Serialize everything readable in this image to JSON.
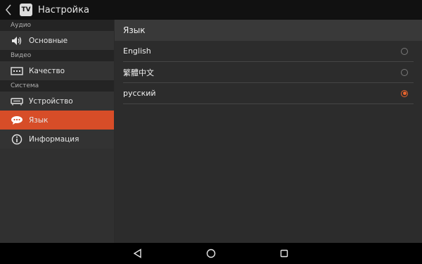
{
  "app": {
    "title": "Настройка",
    "logo_text": "TV"
  },
  "sidebar": {
    "sections": [
      {
        "header": "Аудио",
        "items": [
          {
            "label": "Основные",
            "icon": "speaker-icon",
            "active": false
          }
        ]
      },
      {
        "header": "Видео",
        "items": [
          {
            "label": "Качество",
            "icon": "quality-icon",
            "active": false
          }
        ]
      },
      {
        "header": "Система",
        "items": [
          {
            "label": "Устройство",
            "icon": "device-icon",
            "active": false
          },
          {
            "label": "Язык",
            "icon": "chat-bubble-icon",
            "active": true
          },
          {
            "label": "Информация",
            "icon": "info-icon",
            "active": false
          }
        ]
      }
    ]
  },
  "content": {
    "header": "Язык",
    "languages": [
      {
        "label": "English",
        "selected": false
      },
      {
        "label": "繁體中文",
        "selected": false
      },
      {
        "label": "русский",
        "selected": true
      }
    ]
  },
  "colors": {
    "accent": "#d74d28",
    "radio_selected": "#e8642c"
  }
}
